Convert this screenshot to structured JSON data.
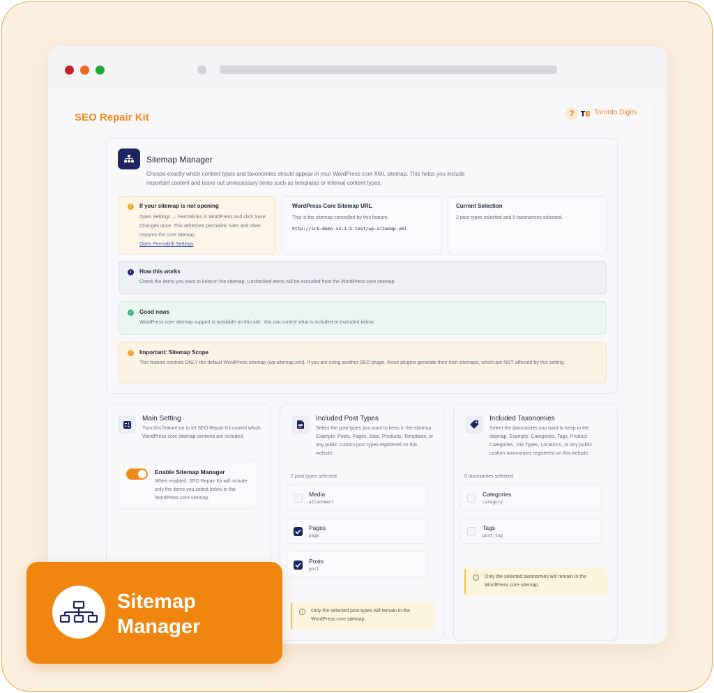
{
  "app": {
    "title": "SEO Repair Kit",
    "help_label": "?",
    "brand_name": "Toronto Digits"
  },
  "feature": {
    "title": "Sitemap Manager",
    "description": "Choose exactly which content types and taxonomies should appear in your WordPress core XML sitemap. This helps you include important content and leave out unnecessary items such as templates or internal content types."
  },
  "notice_not_opening": {
    "title": "If your sitemap is not opening",
    "text": "Open Settings → Permalinks in WordPress and click Save Changes once. This refreshes permalink rules and often restores the core sitemap.",
    "link": "Open Permalink Settings"
  },
  "core_url": {
    "title": "WordPress Core Sitemap URL",
    "text": "This is the sitemap controlled by this feature.",
    "url": "http://srk-demo-v2.1.5.test/wp-sitemap.xml"
  },
  "current_selection": {
    "title": "Current Selection",
    "text": "2 post types selected and 0 taxonomies selected."
  },
  "how_it_works": {
    "title": "How this works",
    "text": "Check the items you want to keep in the sitemap. Unchecked items will be excluded from the WordPress core sitemap."
  },
  "good_news": {
    "title": "Good news",
    "text": "WordPress core sitemap support is available on this site. You can control what is included or excluded below."
  },
  "scope": {
    "title": "Important: Sitemap Scope",
    "text": "This feature controls ONLY the default WordPress sitemap (wp-sitemap.xml). If you are using another SEO plugin, those plugins generate their own sitemaps, which are NOT affected by this setting."
  },
  "main_setting": {
    "title": "Main Setting",
    "description": "Turn this feature on to let SEO Repair Kit control which WordPress core sitemap sections are included.",
    "toggle_label": "Enable Sitemap Manager",
    "toggle_desc": "When enabled, SEO Repair Kit will include only the items you select below in the WordPress core sitemap.",
    "enabled": true
  },
  "post_types": {
    "title": "Included Post Types",
    "description": "Select the post types you want to keep in the sitemap. Example: Posts, Pages, Jobs, Products, Templates, or any public custom post types registered on this website.",
    "count": "2 post types selected.",
    "items": [
      {
        "label": "Media",
        "slug": "attachment",
        "checked": false
      },
      {
        "label": "Pages",
        "slug": "page",
        "checked": true
      },
      {
        "label": "Posts",
        "slug": "post",
        "checked": true
      }
    ],
    "note": "Only the selected post types will remain in the WordPress core sitemap."
  },
  "taxonomies": {
    "title": "Included Taxonomies",
    "description": "Select the taxonomies you want to keep in the sitemap. Example: Categories, Tags, Product Categories, Job Types, Locations, or any public custom taxonomies registered on this website.",
    "count": "0 taxonomies selected.",
    "items": [
      {
        "label": "Categories",
        "slug": "category",
        "checked": false
      },
      {
        "label": "Tags",
        "slug": "post_tag",
        "checked": false
      }
    ],
    "note": "Only the selected taxonomies will remain in the WordPress core sitemap."
  },
  "badge": {
    "title": "Sitemap Manager"
  },
  "colors": {
    "accent": "#ef8a1b",
    "navy": "#1d2460",
    "badge": "#f08510"
  },
  "icons": {
    "feature": "sitemap-icon",
    "help": "question-icon",
    "main_setting": "settings-icon",
    "post_types": "document-icon",
    "taxonomies": "tag-icon"
  }
}
